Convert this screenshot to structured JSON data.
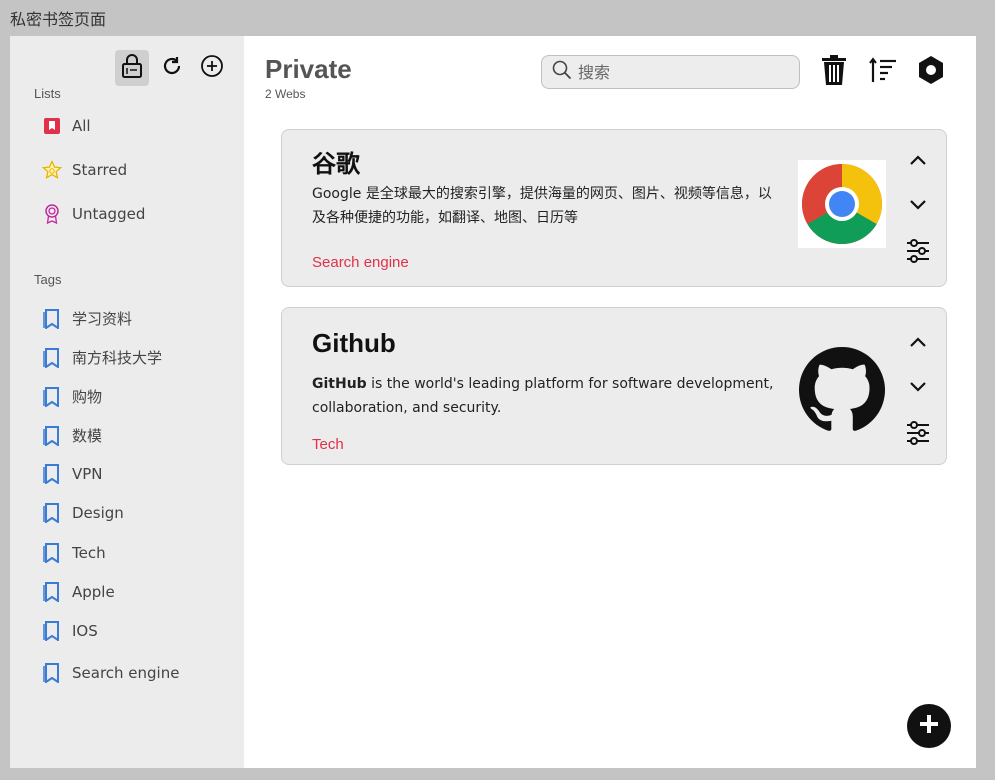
{
  "window_title": "私密书签页面",
  "sidebar": {
    "lists_header": "Lists",
    "lists": [
      {
        "label": "All",
        "icon": "bookmark-filled-icon"
      },
      {
        "label": "Starred",
        "icon": "star-icon"
      },
      {
        "label": "Untagged",
        "icon": "badge-icon"
      }
    ],
    "tags_header": "Tags",
    "tags": [
      {
        "label": "学习资料"
      },
      {
        "label": "南方科技大学"
      },
      {
        "label": "购物"
      },
      {
        "label": "数模"
      },
      {
        "label": "VPN"
      },
      {
        "label": "Design"
      },
      {
        "label": "Tech"
      },
      {
        "label": "Apple"
      },
      {
        "label": "IOS"
      },
      {
        "label": "Search engine"
      }
    ],
    "toolbar_icons": [
      "lock-icon",
      "refresh-icon",
      "add-circle-icon"
    ]
  },
  "header": {
    "title": "Private",
    "subtitle": "2 Webs",
    "search_placeholder": "搜索"
  },
  "top_icons": [
    "trash-icon",
    "sort-icon",
    "settings-icon"
  ],
  "cards": [
    {
      "title": "谷歌",
      "description": "Google 是全球最大的搜索引擎，提供海量的网页、图片、视频等信息，以及各种便捷的功能，如翻译、地图、日历等",
      "tag": "Search engine",
      "logo": "chrome-logo-icon"
    },
    {
      "title": "Github",
      "description_bold": "GitHub",
      "description": " is the world's leading platform for software development, collaboration, and security.",
      "tag": "Tech",
      "logo": "github-logo-icon"
    }
  ],
  "colors": {
    "accent_red": "#e0304a",
    "bookmark_blue": "#3a7bd5",
    "sidebar_bg": "#ececec",
    "card_bg": "#ececec"
  }
}
